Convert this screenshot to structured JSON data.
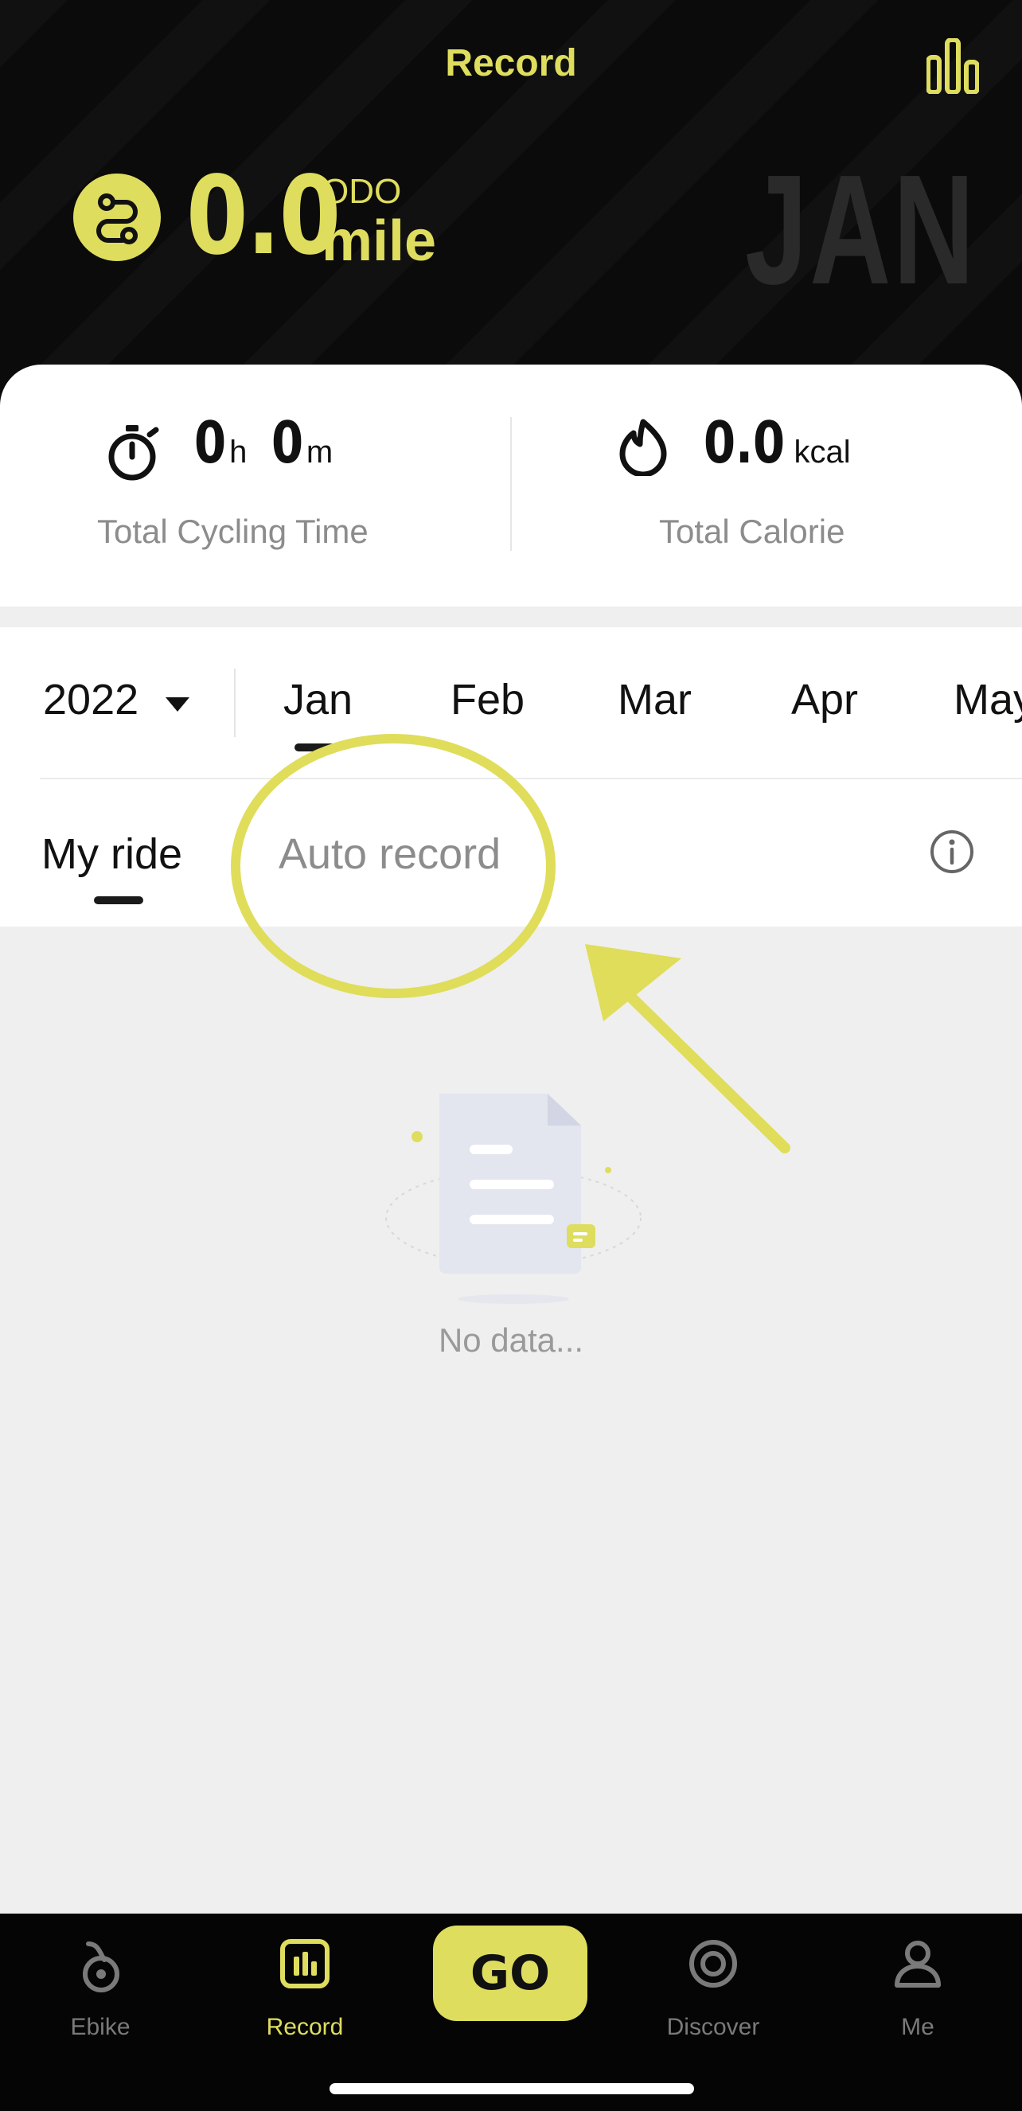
{
  "header": {
    "title": "Record",
    "odo_value": "0.0",
    "odo_label": "ODO",
    "odo_unit": "mile",
    "month_watermark": "JAN",
    "stats_icon": "bar-chart-icon",
    "odo_icon": "route-icon"
  },
  "summary": {
    "time": {
      "hours": "0",
      "hours_unit": "h",
      "minutes": "0",
      "minutes_unit": "m",
      "caption": "Total Cycling Time",
      "icon": "stopwatch-icon"
    },
    "calorie": {
      "value": "0.0",
      "unit": "kcal",
      "caption": "Total Calorie",
      "icon": "flame-icon"
    }
  },
  "selector": {
    "year": "2022",
    "months": [
      "Jan",
      "Feb",
      "Mar",
      "Apr",
      "May"
    ],
    "selected_month": "Jan"
  },
  "tabs": {
    "items": [
      "My ride",
      "Auto record"
    ],
    "selected": "My ride",
    "info_icon": "info-icon"
  },
  "empty": {
    "text": "No data...",
    "icon": "document-icon"
  },
  "nav": {
    "items": [
      {
        "label": "Ebike",
        "icon": "ebike-icon"
      },
      {
        "label": "Record",
        "icon": "record-icon"
      },
      {
        "label": "Discover",
        "icon": "discover-icon"
      },
      {
        "label": "Me",
        "icon": "person-icon"
      }
    ],
    "go_label": "GO",
    "active": "Record"
  },
  "colors": {
    "accent": "#dedd5e",
    "header_bg": "#0b0b0b",
    "page_bg": "#efefef"
  }
}
